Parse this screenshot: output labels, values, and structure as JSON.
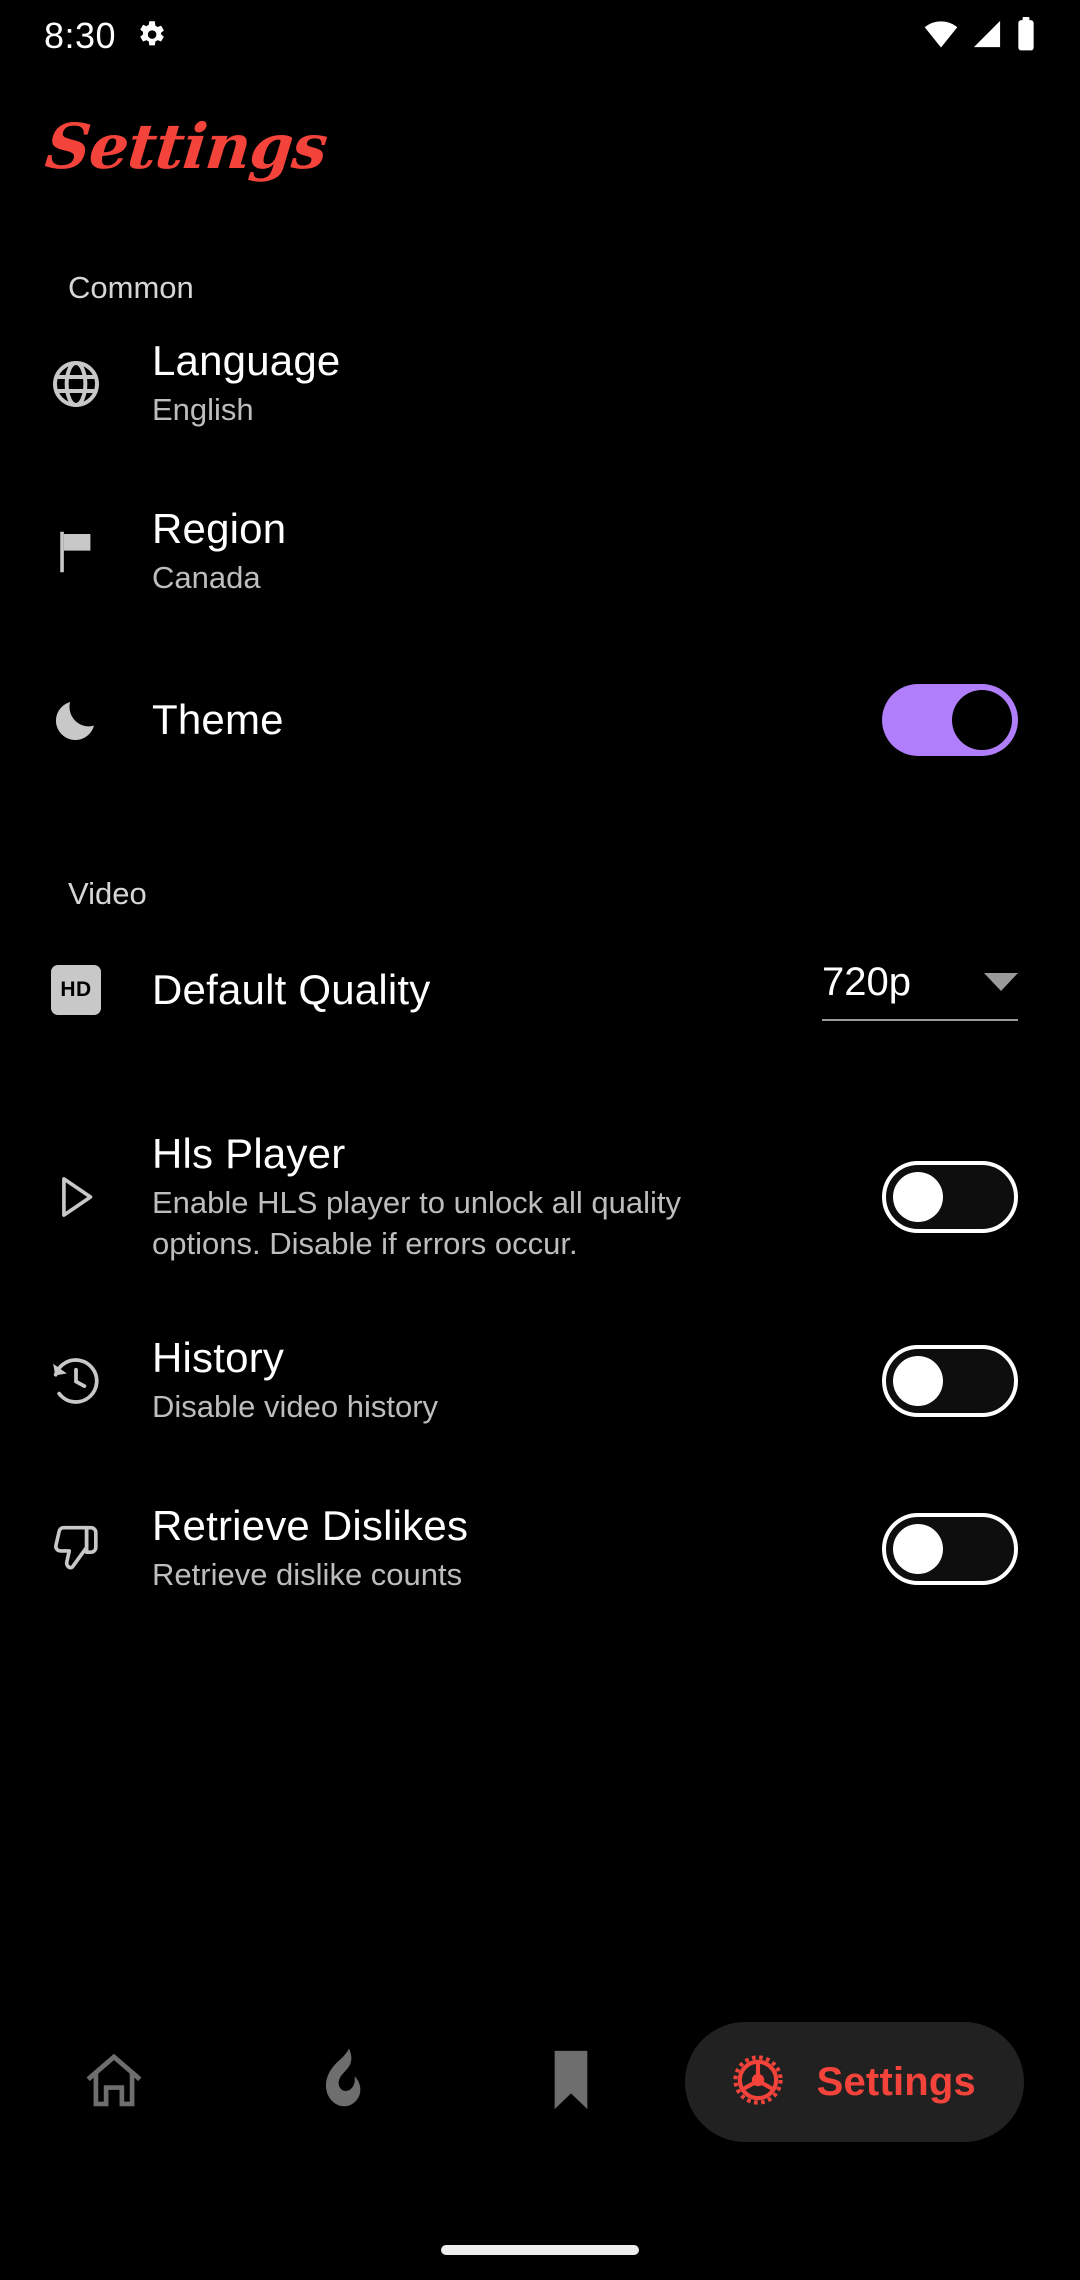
{
  "status_bar": {
    "time": "8:30",
    "left_icons": [
      "gear-icon"
    ],
    "right_icons": [
      "wifi-icon",
      "cellular-signal-icon",
      "battery-icon"
    ]
  },
  "header": {
    "title": "Settings",
    "title_color": "#F4433A"
  },
  "sections": [
    {
      "label": "Common",
      "rows": [
        {
          "icon": "globe-icon",
          "title": "Language",
          "subtitle": "English",
          "control": "none"
        },
        {
          "icon": "flag-icon",
          "title": "Region",
          "subtitle": "Canada",
          "control": "none"
        },
        {
          "icon": "moon-icon",
          "title": "Theme",
          "subtitle": "",
          "control": "toggle",
          "toggle_on": true
        }
      ]
    },
    {
      "label": "Video",
      "rows": [
        {
          "icon": "hd-badge-icon",
          "title": "Default Quality",
          "subtitle": "",
          "control": "dropdown",
          "dropdown_value": "720p"
        },
        {
          "icon": "play-triangle-icon",
          "title": "Hls Player",
          "subtitle": "Enable HLS player to unlock all quality options. Disable if errors occur.",
          "control": "toggle",
          "toggle_on": false
        },
        {
          "icon": "history-icon",
          "title": "History",
          "subtitle": "Disable video history",
          "control": "toggle",
          "toggle_on": false
        },
        {
          "icon": "thumb-down-icon",
          "title": "Retrieve Dislikes",
          "subtitle": "Retrieve dislike counts",
          "control": "toggle",
          "toggle_on": false
        }
      ]
    }
  ],
  "bottom_nav": {
    "items": [
      {
        "icon": "home-icon",
        "label": "",
        "selected": false
      },
      {
        "icon": "flame-icon",
        "label": "",
        "selected": false
      },
      {
        "icon": "bookmark-icon",
        "label": "",
        "selected": false
      },
      {
        "icon": "gear-icon",
        "label": "Settings",
        "selected": true
      }
    ],
    "accent_color": "#F4433A",
    "pill_background": "#212121"
  },
  "colors": {
    "background": "#000000",
    "toggle_on": "#B07EFA",
    "toggle_off_border": "#FFFFFF",
    "subtitle": "#BDBDBD",
    "icon_gray": "#C8C8C8"
  }
}
